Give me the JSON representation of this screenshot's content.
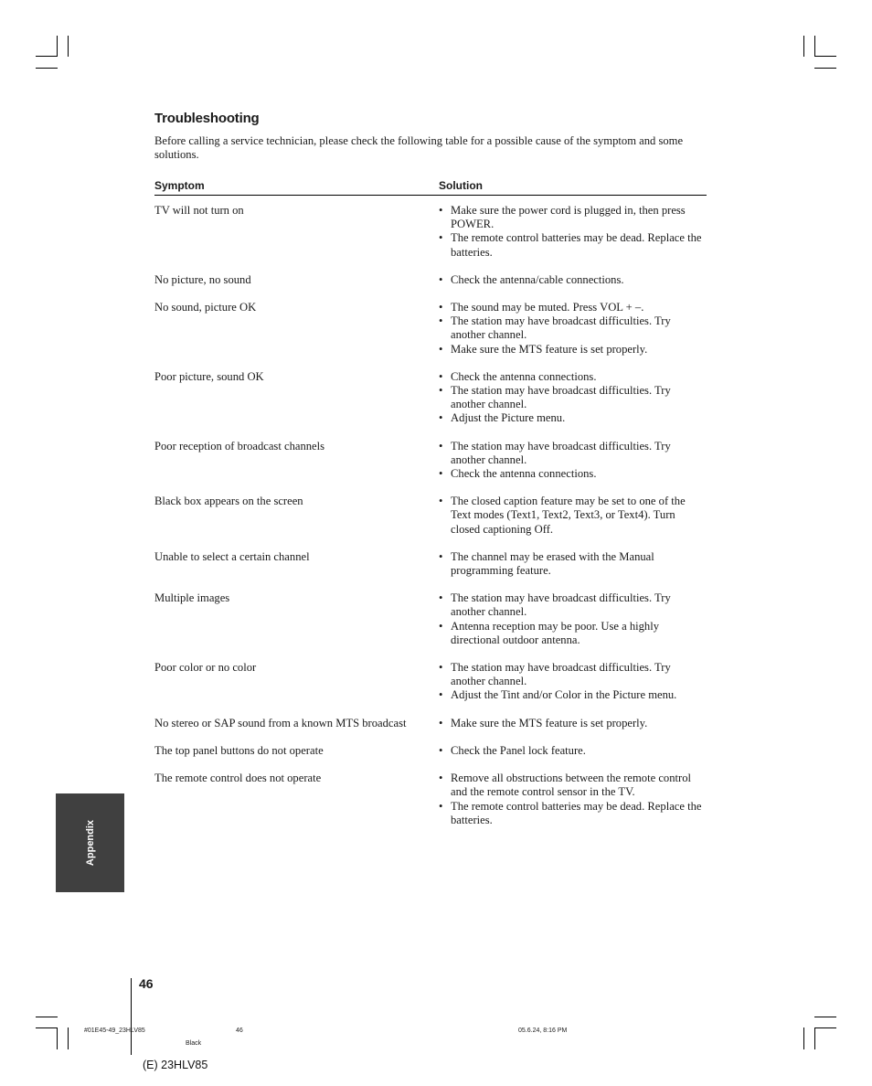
{
  "page": {
    "title": "Troubleshooting",
    "intro": "Before calling a service technician, please check the following table for a possible cause of the symptom and some solutions.",
    "table": {
      "headers": {
        "symptom": "Symptom",
        "solution": "Solution"
      },
      "rows": [
        {
          "symptom": "TV will not turn on",
          "solutions": [
            "Make sure the power cord is plugged in, then press POWER.",
            "The remote control batteries may be dead. Replace the batteries."
          ]
        },
        {
          "symptom": "No picture, no sound",
          "solutions": [
            "Check the antenna/cable connections."
          ]
        },
        {
          "symptom": "No sound, picture OK",
          "solutions": [
            "The sound may be muted. Press VOL + –.",
            "The station may have broadcast difficulties. Try another channel.",
            "Make sure the MTS feature is set properly."
          ]
        },
        {
          "symptom": "Poor picture, sound OK",
          "solutions": [
            "Check the antenna connections.",
            "The station may have broadcast difficulties. Try another channel.",
            "Adjust the Picture menu."
          ]
        },
        {
          "symptom": "Poor reception of broadcast channels",
          "solutions": [
            "The station may have broadcast difficulties. Try another channel.",
            "Check the antenna connections."
          ]
        },
        {
          "symptom": "Black box appears on the screen",
          "solutions": [
            "The closed caption feature may be set to one of the Text modes (Text1, Text2, Text3, or Text4). Turn closed captioning Off."
          ]
        },
        {
          "symptom": "Unable to select a certain channel",
          "solutions": [
            "The channel may be erased with the Manual programming feature."
          ]
        },
        {
          "symptom": "Multiple images",
          "solutions": [
            "The station may have broadcast difficulties. Try another channel.",
            "Antenna reception may be poor. Use a highly directional outdoor antenna."
          ]
        },
        {
          "symptom": "Poor color or no color",
          "solutions": [
            "The station may have broadcast difficulties. Try another channel.",
            "Adjust the Tint and/or Color in the Picture menu."
          ]
        },
        {
          "symptom": "No stereo or SAP sound from a known MTS broadcast",
          "solutions": [
            "Make sure the MTS feature is set properly."
          ]
        },
        {
          "symptom": "The top panel buttons do not operate",
          "solutions": [
            "Check the Panel lock feature."
          ]
        },
        {
          "symptom": "The remote control does not operate",
          "solutions": [
            "Remove all obstructions between the remote control and the remote control sensor in the TV.",
            "The remote control batteries may be dead. Replace the batteries."
          ]
        }
      ]
    },
    "side_tab": {
      "label": "Appendix",
      "color": "#404040"
    },
    "page_number": "46"
  },
  "print_slug": {
    "file": "#01E45-49_23HLV85",
    "page": "46",
    "datetime": "05.6.24, 8:16 PM",
    "ink": "Black",
    "model": "(E) 23HLV85"
  }
}
